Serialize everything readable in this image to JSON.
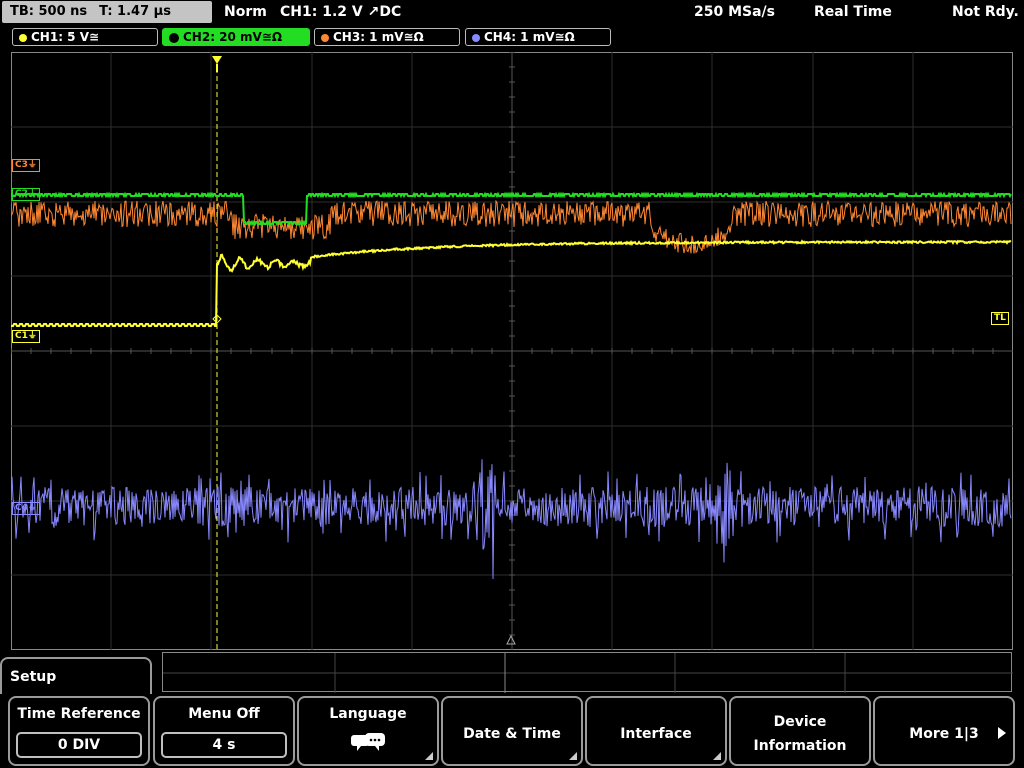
{
  "topbar": {
    "timebase": "TB: 500 ns",
    "trigger_time": "T: 1.47 µs",
    "mode": "Norm",
    "trigger_info": "CH1: 1.2 V ↗DC",
    "sample_rate": "250 MSa/s",
    "acq_mode": "Real Time",
    "status": "Not Rdy."
  },
  "channels": [
    {
      "label": "CH1: 5 V≅",
      "color": "#ffff33",
      "active": false
    },
    {
      "label": "CH2: 20 mV≅Ω",
      "color": "#22dd22",
      "active": true
    },
    {
      "label": "CH3: 1 mV≅Ω",
      "color": "#ff8833",
      "active": false
    },
    {
      "label": "CH4: 1 mV≅Ω",
      "color": "#8888ff",
      "active": false
    }
  ],
  "markers": {
    "c3": "C3⏚",
    "c2": "C2⏚",
    "c1": "C1⏚",
    "c4": "C4⏚",
    "trigger_level": "TL"
  },
  "menu": {
    "title": "Setup",
    "softkeys": [
      {
        "label": "Time Reference",
        "value": "0 DIV"
      },
      {
        "label": "Menu Off",
        "value": "4 s"
      },
      {
        "label": "Language",
        "icon": "speech-bubble-icon"
      },
      {
        "label": "Date & Time"
      },
      {
        "label": "Interface"
      },
      {
        "label_line1": "Device",
        "label_line2": "Information"
      },
      {
        "label": "More 1|3"
      }
    ]
  },
  "colors": {
    "ch1": "#ffff33",
    "ch2": "#22dd22",
    "ch3": "#ff8833",
    "ch4": "#8888ff"
  }
}
